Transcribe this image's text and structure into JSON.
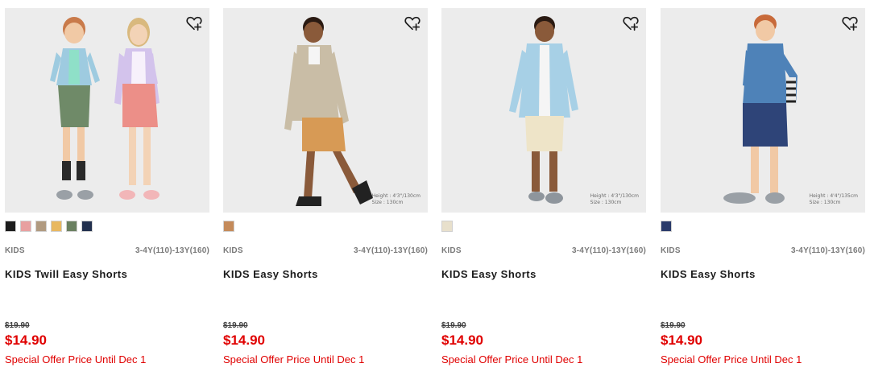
{
  "products": [
    {
      "category": "KIDS",
      "sizes": "3-4Y(110)-13Y(160)",
      "name": "KIDS Twill Easy Shorts",
      "old_price": "$19.90",
      "price": "$14.90",
      "promo": "Special Offer Price Until Dec 1",
      "model_note": [],
      "swatches": [
        "#1c1c1c",
        "#e8a0a0",
        "#b09a80",
        "#e8b860",
        "#6a8060",
        "#22304e"
      ]
    },
    {
      "category": "KIDS",
      "sizes": "3-4Y(110)-13Y(160)",
      "name": "KIDS Easy Shorts",
      "old_price": "$19.90",
      "price": "$14.90",
      "promo": "Special Offer Price Until Dec 1",
      "model_note": [
        "Height : 4'3\"/130cm",
        "Size : 130cm"
      ],
      "swatches": [
        "#c48a5a"
      ]
    },
    {
      "category": "KIDS",
      "sizes": "3-4Y(110)-13Y(160)",
      "name": "KIDS Easy Shorts",
      "old_price": "$19.90",
      "price": "$14.90",
      "promo": "Special Offer Price Until Dec 1",
      "model_note": [
        "Height : 4'3\"/130cm",
        "Size : 130cm"
      ],
      "swatches": [
        "#e8e0cc"
      ]
    },
    {
      "category": "KIDS",
      "sizes": "3-4Y(110)-13Y(160)",
      "name": "KIDS Easy Shorts",
      "old_price": "$19.90",
      "price": "$14.90",
      "promo": "Special Offer Price Until Dec 1",
      "model_note": [
        "Height : 4'4\"/135cm",
        "Size : 130cm"
      ],
      "swatches": [
        "#2a3a6a"
      ]
    }
  ],
  "icons": {
    "favorite": "heart-plus-icon"
  },
  "colors": {
    "sale_red": "#e00000",
    "image_bg": "#ececec"
  }
}
